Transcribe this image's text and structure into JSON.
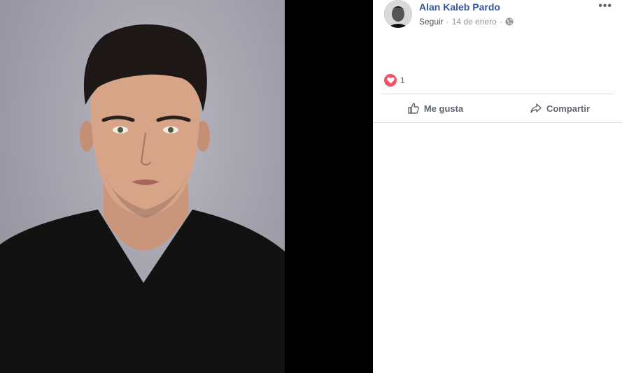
{
  "post": {
    "author": "Alan Kaleb Pardo",
    "follow_label": "Seguir",
    "separator": "·",
    "date": "14 de enero",
    "privacy_icon": "globe-icon",
    "more_label": "•••"
  },
  "reactions": {
    "icon": "heart-reaction-icon",
    "count": "1"
  },
  "actions": {
    "like_label": "Me gusta",
    "share_label": "Compartir"
  },
  "colors": {
    "author_link": "#365899",
    "heart": "#f25268",
    "muted": "#90949c"
  }
}
